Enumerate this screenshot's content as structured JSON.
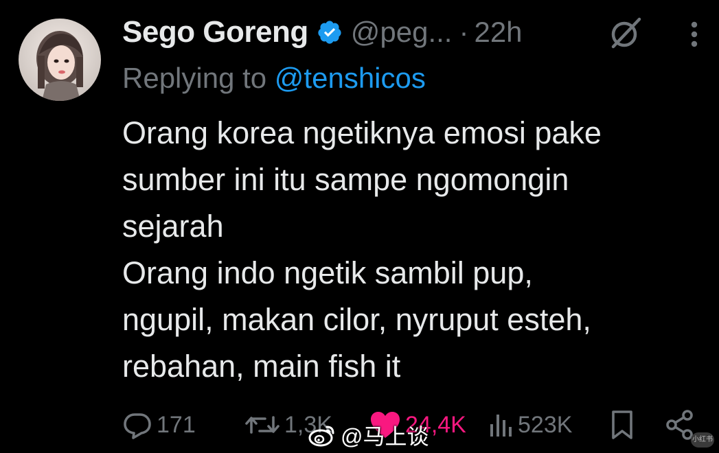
{
  "author": {
    "display_name": "Sego Goreng",
    "handle": "@peg...",
    "time_separator": "·",
    "time": "22h",
    "verified": true
  },
  "reply": {
    "prefix": "Replying to",
    "mention": "@tenshicos"
  },
  "body": {
    "lines": [
      "Orang korea ngetiknya emosi pake",
      "sumber ini itu sampe ngomongin",
      "sejarah",
      "Orang indo ngetik sambil pup,",
      "ngupil, makan cilor, nyruput esteh,",
      "rebahan, main fish it"
    ]
  },
  "actions": {
    "replies": "171",
    "reposts": "1,3K",
    "likes": "24,4K",
    "views": "523K"
  },
  "icons": {
    "verified": "verified-badge-icon",
    "grok": "grok-icon",
    "more": "more-vertical-icon",
    "reply": "reply-icon",
    "repost": "repost-icon",
    "like": "heart-filled-icon",
    "views": "views-chart-icon",
    "bookmark": "bookmark-icon",
    "share": "share-icon"
  },
  "watermark": {
    "text": "@马上谈"
  },
  "corner_badge": {
    "text": "小红书"
  },
  "colors": {
    "background": "#000000",
    "primary_text": "#e7e9ea",
    "secondary_text": "#71767b",
    "link": "#1d9bf0",
    "verified": "#1d9bf0",
    "like": "#f91880"
  }
}
